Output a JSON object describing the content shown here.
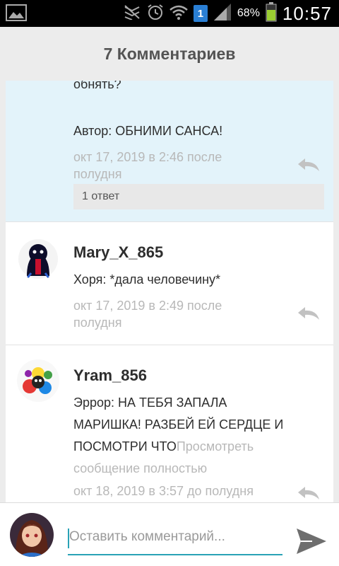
{
  "status_bar": {
    "battery_percent": "68%",
    "time": "10:57",
    "sim_label": "1"
  },
  "header": {
    "title": "7 Комментариев"
  },
  "comments": [
    {
      "text_partial": "обнять?",
      "author_line": "Автор:  ОБНИМИ САНСА!",
      "time_line1": "окт 17, 2019 в 2:46 после",
      "time_line2": "полудня",
      "replies_label": "1 ответ"
    },
    {
      "username": "Mary_X_865",
      "text": "Хоря: *дала человечину*",
      "time_line1": "окт 17, 2019 в 2:49 после",
      "time_line2": "полудня"
    },
    {
      "username": "Yram_856",
      "text_line1": "Эррор: НА ТЕБЯ ЗАПАЛА",
      "text_line2": "МАРИШКА! РАЗБЕЙ ЕЙ СЕРДЦЕ И",
      "text_line3": "ПОСМОТРИ ЧТО",
      "more_1": "Просмотреть",
      "more_2": "сообщение полностью",
      "time_line1": "окт 18, 2019 в 3:57 до полудня"
    }
  ],
  "composer": {
    "placeholder": "Оставить комментарий..."
  },
  "colors": {
    "accent": "#29a2b6",
    "highlight_bg": "#e3f3fa",
    "timestamp": "#b8b8b8"
  },
  "icons": [
    "gallery-icon",
    "mute-icon",
    "alarm-icon",
    "wifi-icon",
    "signal-icon",
    "battery-icon",
    "reply-icon",
    "send-icon"
  ]
}
